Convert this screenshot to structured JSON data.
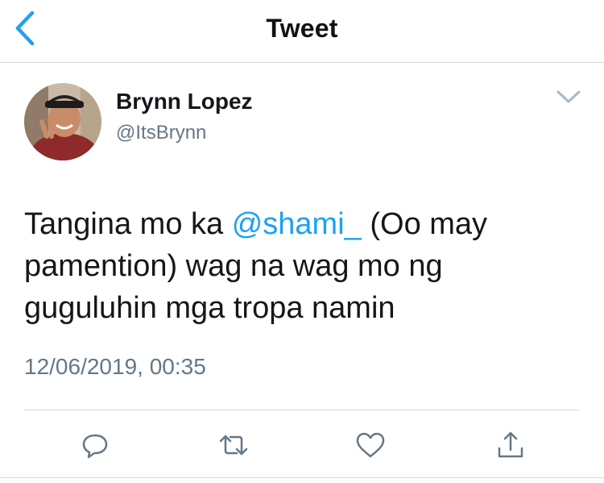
{
  "header": {
    "title": "Tweet",
    "back_icon": "chevron-left-icon",
    "accent_color": "#1da1f2"
  },
  "tweet": {
    "author": {
      "display_name": "Brynn Lopez",
      "handle": "@ItsBrynn"
    },
    "text_before_mention": "Tangina mo ka ",
    "mention": "@shami_",
    "text_after_mention": " (Oo may pamention) wag na wag mo ng guguluhin mga tropa namin",
    "timestamp": "12/06/2019, 00:35",
    "menu_icon": "chevron-down-icon"
  },
  "actions": [
    {
      "name": "reply",
      "icon": "comment-icon"
    },
    {
      "name": "retweet",
      "icon": "retweet-icon"
    },
    {
      "name": "like",
      "icon": "heart-icon"
    },
    {
      "name": "share",
      "icon": "share-icon"
    }
  ],
  "colors": {
    "text": "#14171a",
    "secondary": "#657786",
    "mention": "#1da1f2",
    "divider": "#d5d9dc"
  }
}
